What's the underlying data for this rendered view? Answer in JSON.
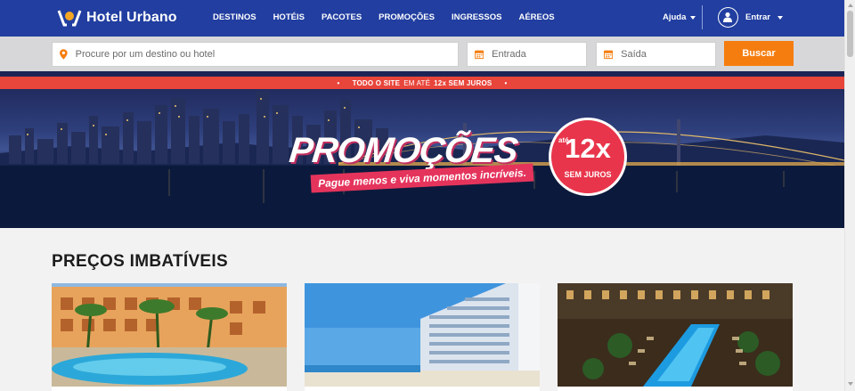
{
  "brand": {
    "name": "Hotel Urbano"
  },
  "nav": {
    "items": [
      "DESTINOS",
      "HOTÉIS",
      "PACOTES",
      "PROMOÇÕES",
      "INGRESSOS",
      "AÉREOS"
    ]
  },
  "header": {
    "help_label": "Ajuda",
    "login_label": "Entrar"
  },
  "search": {
    "destination_placeholder": "Procure por um destino ou hotel",
    "checkin_placeholder": "Entrada",
    "checkout_placeholder": "Saída",
    "button_label": "Buscar"
  },
  "banner": {
    "strip_part1": "TODO O SITE",
    "strip_part2": "EM ATÉ",
    "strip_part3": "12x SEM JUROS",
    "title": "PROMOÇÕES",
    "subtitle": "Pague menos e viva momentos incríveis.",
    "badge_ate": "até",
    "badge_value": "12x",
    "badge_text": "SEM JUROS"
  },
  "section": {
    "title": "PREÇOS IMBATÍVEIS"
  },
  "colors": {
    "header_bg": "#213ea0",
    "accent_orange": "#f57d0f",
    "promo_red": "#e8453b"
  },
  "icons": {
    "search_location": "location-pin-icon",
    "calendar": "calendar-icon",
    "user": "user-icon",
    "caret": "chevron-down-icon"
  }
}
